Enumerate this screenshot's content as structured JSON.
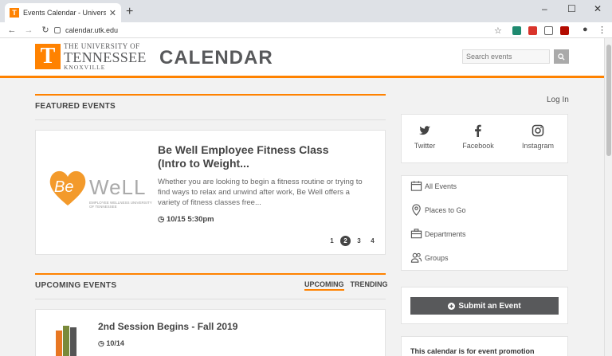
{
  "browser": {
    "tab_title": "Events Calendar - University of Te",
    "favicon_letter": "T",
    "url": "calendar.utk.edu",
    "window_controls": [
      "–",
      "☐",
      "✕"
    ]
  },
  "header": {
    "logo_letter": "T",
    "univ_line1": "THE UNIVERSITY OF",
    "univ_line2": "TENNESSEE",
    "univ_line3": "KNOXVILLE",
    "site_title": "CALENDAR",
    "search_placeholder": "Search events"
  },
  "featured": {
    "section_title": "FEATURED EVENTS",
    "logo_be": "Be",
    "logo_well": "WeLL",
    "logo_sub": "EMPLOYEE WELLNESS UNIVERSITY OF TENNESSEE",
    "title": "Be Well Employee Fitness Class (Intro to Weight...",
    "description": "Whether you are looking to begin a fitness routine or trying to find ways to relax and unwind after work, Be Well offers a variety of fitness classes free...",
    "time": "10/15 5:30pm",
    "pages": [
      "1",
      "2",
      "3",
      "4"
    ],
    "active_page": "2"
  },
  "upcoming": {
    "section_title": "UPCOMING EVENTS",
    "tab_upcoming": "UPCOMING",
    "tab_trending": "TRENDING",
    "event_title": "2nd Session Begins - Fall 2019",
    "event_date": "10/14"
  },
  "sidebar": {
    "login": "Log In",
    "social": [
      {
        "label": "Twitter",
        "icon": "twitter-icon"
      },
      {
        "label": "Facebook",
        "icon": "facebook-icon"
      },
      {
        "label": "Instagram",
        "icon": "instagram-icon"
      }
    ],
    "links": [
      {
        "label": "All Events",
        "icon": "calendar-icon"
      },
      {
        "label": "Places to Go",
        "icon": "map-pin-icon"
      },
      {
        "label": "Departments",
        "icon": "briefcase-icon"
      },
      {
        "label": "Groups",
        "icon": "groups-icon"
      }
    ],
    "submit_label": "Submit an Event",
    "promo_text": "This calendar is for event promotion"
  },
  "colors": {
    "accent": "#ff8200",
    "smokey": "#58595b"
  }
}
